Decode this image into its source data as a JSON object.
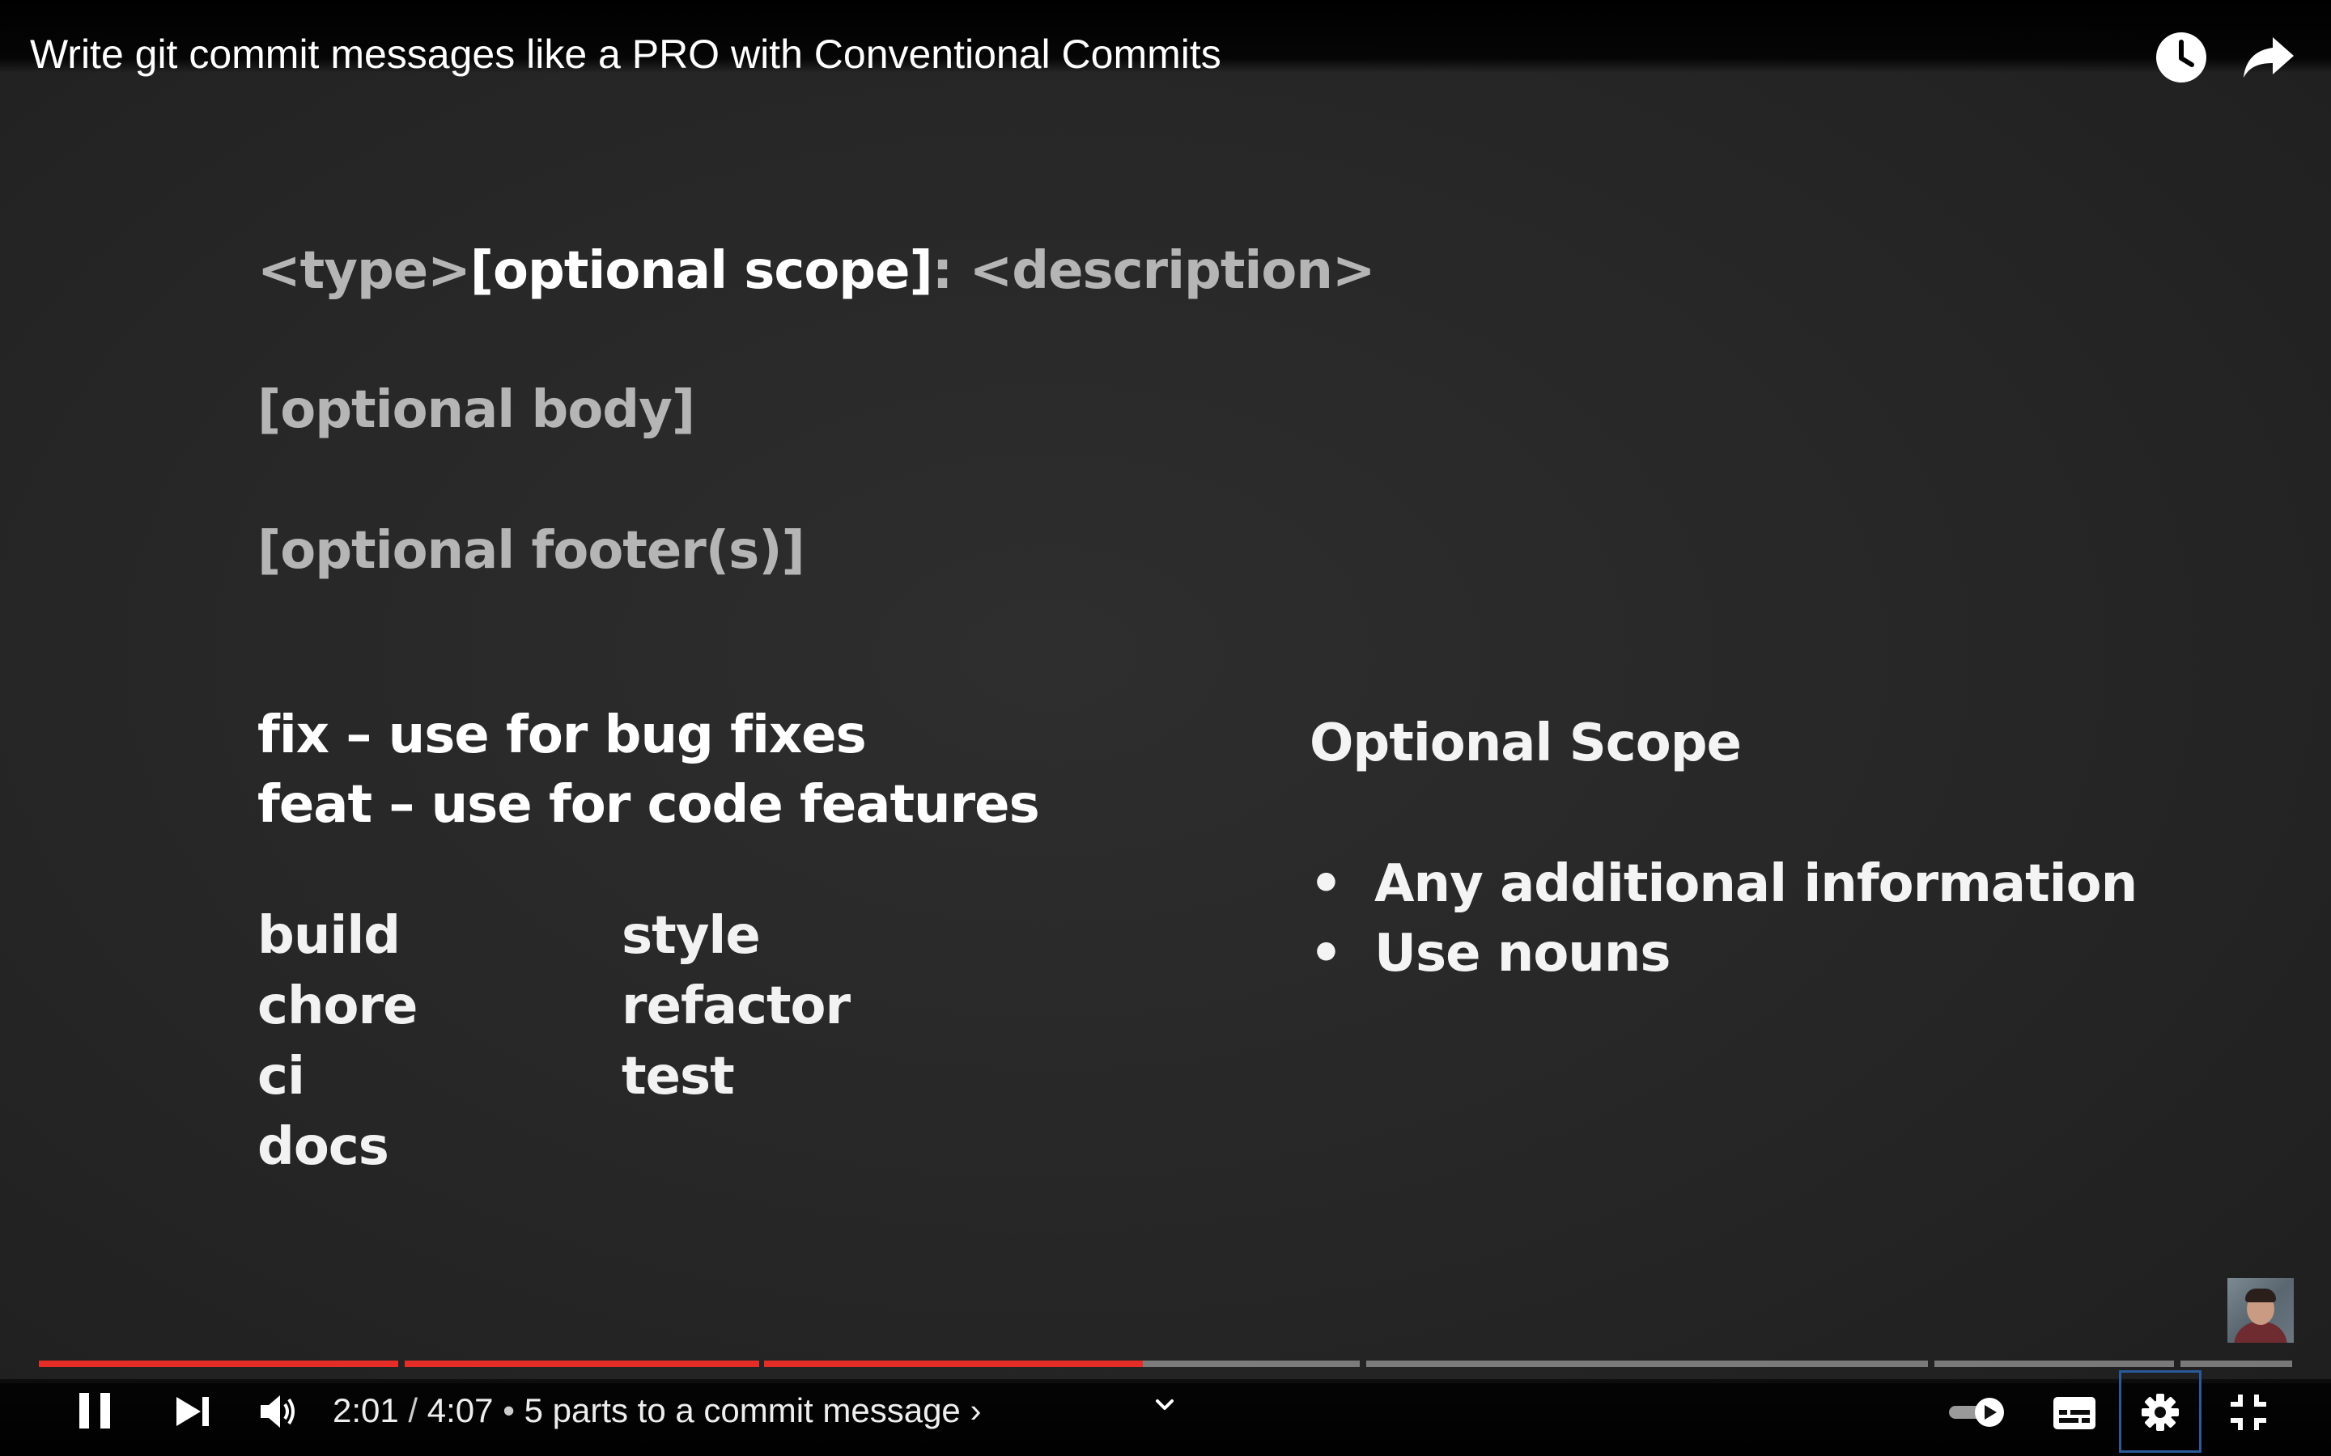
{
  "video": {
    "title": "Write git commit messages like a PRO with Conventional Commits"
  },
  "slide": {
    "header_type": "<type>",
    "header_scope": "[optional scope]",
    "header_colon": ":",
    "header_description": "<description>",
    "body": "[optional body]",
    "footer": "[optional footer(s)]",
    "fix": "fix – use for bug fixes",
    "feat": "feat – use for code features",
    "types_left": [
      "build",
      "chore",
      "ci",
      "docs"
    ],
    "types_right": [
      "style",
      "refactor",
      "test"
    ],
    "scope_title": "Optional Scope",
    "scope_bullets": [
      "Any additional information",
      "Use nouns"
    ]
  },
  "player": {
    "current_time": "2:01",
    "duration": "4:07",
    "time_separator": "/",
    "dot_separator": "•",
    "chapter_title": "5 parts to a commit message",
    "chapter_arrow": "›",
    "played_fraction": 0.49,
    "progress_color": "#e52d27",
    "icons": {
      "top": [
        "watch-later-icon",
        "share-icon"
      ],
      "controls": [
        "pause-icon",
        "next-icon",
        "volume-icon",
        "chevron-down-icon",
        "autoplay-toggle-icon",
        "subtitles-icon",
        "settings-icon",
        "exit-fullscreen-icon"
      ]
    }
  }
}
